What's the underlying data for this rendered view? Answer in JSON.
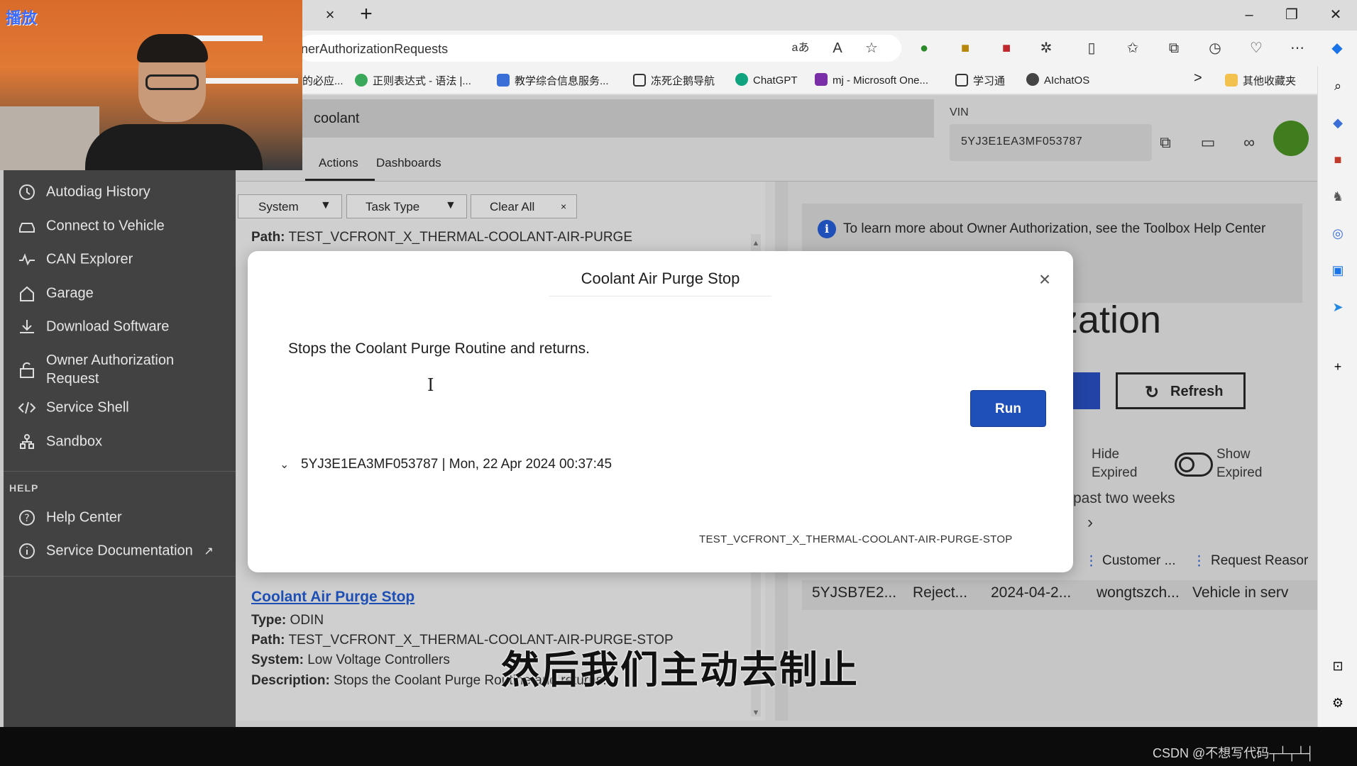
{
  "browser": {
    "url": "nerAuthorizationRequests",
    "tab_close": "×",
    "tab_new": "+",
    "window": {
      "minimize": "–",
      "restore": "❐",
      "close": "✕"
    },
    "bookmarks": [
      "的必应...",
      "正则表达式 - 语法 |...",
      "教学综合信息服务...",
      "冻死企鹅导航",
      "ChatGPT",
      "mj - Microsoft One...",
      "学习通",
      "AIchatOS",
      "其他收藏夹"
    ],
    "bookmarks_more": ">"
  },
  "webcam": {
    "label": "播放"
  },
  "nav": {
    "items": [
      "Autodiag History",
      "Connect to Vehicle",
      "CAN Explorer",
      "Garage",
      "Download Software",
      "Owner Authorization Request",
      "Service Shell",
      "Sandbox"
    ],
    "help_heading": "HELP",
    "help_items": [
      "Help Center",
      "Service Documentation"
    ]
  },
  "header": {
    "search_value": "coolant",
    "vin_label": "VIN",
    "vin_value": "5YJ3E1EA3MF053787",
    "tabs": [
      "Actions",
      "Dashboards"
    ]
  },
  "filters": {
    "system": "System",
    "task_type": "Task Type",
    "clear_all": "Clear All",
    "clear_x": "×"
  },
  "list": {
    "top_path_label": "Path:",
    "top_path_value": "TEST_VCFRONT_X_THERMAL-COOLANT-AIR-PURGE",
    "item_title": "Coolant Air Purge Stop",
    "type_label": "Type:",
    "type_value": "ODIN",
    "path_label": "Path:",
    "path_value": "TEST_VCFRONT_X_THERMAL-COOLANT-AIR-PURGE-STOP",
    "system_label": "System:",
    "system_value": "Low Voltage Controllers",
    "desc_label": "Description:",
    "desc_value": "Stops the Coolant Purge Routine and returns."
  },
  "right": {
    "info_text": "To learn more about Owner Authorization, see the Toolbox Help Center tutorial",
    "title_fragment": "ization",
    "refresh_label": "Refresh",
    "hide_expired": "Hide Expired",
    "show_expired": "Show Expired",
    "past_two_weeks": "past two weeks",
    "chevron": "›",
    "table_headers": [
      "Customer ...",
      "Request Reasor"
    ],
    "table_row": [
      "5YJSB7E2...",
      "Reject...",
      "2024-04-2...",
      "wongtszch...",
      "Vehicle in serv"
    ]
  },
  "modal": {
    "title": "Coolant Air Purge Stop",
    "close": "×",
    "description": "Stops the Coolant Purge Routine and returns.",
    "run_label": "Run",
    "accordion_label": "5YJ3E1EA3MF053787 | Mon, 22 Apr 2024 00:37:45",
    "path": "TEST_VCFRONT_X_THERMAL-COOLANT-AIR-PURGE-STOP"
  },
  "subtitle": "然后我们主动去制止",
  "watermark": "CSDN @不想写代码┬┴┬┴┤"
}
